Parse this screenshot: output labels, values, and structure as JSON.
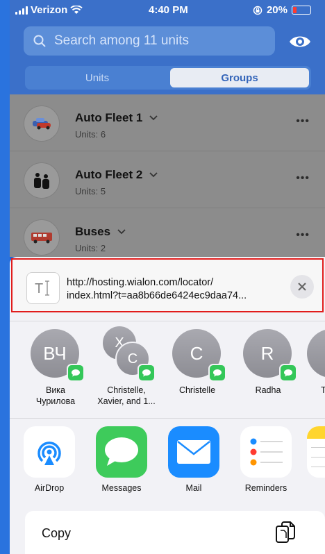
{
  "status_bar": {
    "carrier": "Verizon",
    "time": "4:40 PM",
    "battery": "20%",
    "battery_level": 0.2,
    "icons": [
      "signal-icon",
      "wifi-icon",
      "orientation-lock-icon",
      "battery-icon"
    ]
  },
  "search": {
    "placeholder": "Search among 11 units"
  },
  "tabs": [
    {
      "label": "Units",
      "selected": false
    },
    {
      "label": "Groups",
      "selected": true
    }
  ],
  "groups": [
    {
      "name": "Auto Fleet 1",
      "units": "Units: 6",
      "icon": "cars-icon"
    },
    {
      "name": "Auto Fleet 2",
      "units": "Units: 5",
      "icon": "people-icon"
    },
    {
      "name": "Buses",
      "units": "Units: 2",
      "icon": "bus-icon"
    }
  ],
  "share": {
    "link_line1": "http://hosting.wialon.com/locator/",
    "link_line2": "index.html?t=aa8b66de6424ec9daa74...",
    "people": [
      {
        "initials": "ВЧ",
        "label_line1": "Вика",
        "label_line2": "Чурилова"
      },
      {
        "initials_back": "X",
        "initials_front": "C",
        "label_line1": "Christelle,",
        "label_line2": "Xavier, and 1..."
      },
      {
        "initials": "C",
        "label_line1": "Christelle",
        "label_line2": ""
      },
      {
        "initials": "R",
        "label_line1": "Radha",
        "label_line2": ""
      },
      {
        "initials": "T",
        "label_line1": "T",
        "label_line2": ""
      }
    ],
    "apps": [
      {
        "label": "AirDrop",
        "icon": "airdrop-icon"
      },
      {
        "label": "Messages",
        "icon": "messages-icon"
      },
      {
        "label": "Mail",
        "icon": "mail-icon"
      },
      {
        "label": "Reminders",
        "icon": "reminders-icon"
      },
      {
        "label": "",
        "icon": "notes-icon"
      }
    ],
    "copy_label": "Copy"
  },
  "colors": {
    "header": "#3b70c9",
    "highlight_border": "#e11c1c",
    "messages_green": "#34c759",
    "mail_blue": "#1a8cff"
  }
}
